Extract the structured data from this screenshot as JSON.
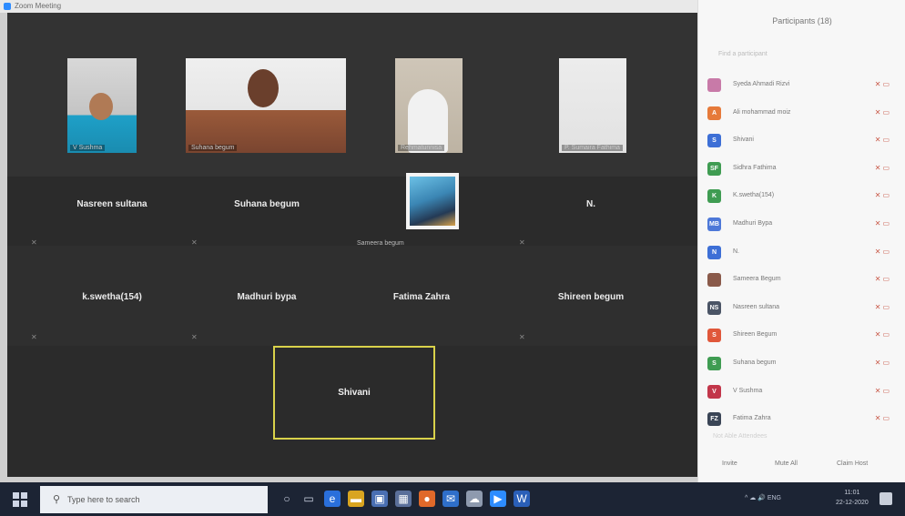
{
  "window": {
    "title": "Zoom Meeting"
  },
  "video_tiles": [
    {
      "label": "V Sushma"
    },
    {
      "label": "Suhana begum"
    },
    {
      "label": "Rehmatunnisa"
    },
    {
      "label": "P. Sumaira Fathima"
    }
  ],
  "name_tiles": [
    "Nasreen sultana",
    "Suhana begum",
    "N.",
    "k.swetha(154)",
    "Madhuri bypa",
    "Fatima Zahra",
    "Shireen begum"
  ],
  "avatar_tile": {
    "label": "Sameera begum"
  },
  "active_speaker": {
    "name": "Shivani"
  },
  "participants_panel": {
    "title": "Participants (18)",
    "search_placeholder": "Find a participant",
    "participants": [
      {
        "initials": "",
        "name": "Syeda Ahmadi Rizvi",
        "color": "#c87aa8"
      },
      {
        "initials": "A",
        "name": "Ali mohammad moiz",
        "color": "#e67a3a"
      },
      {
        "initials": "S",
        "name": "Shivani",
        "color": "#3d6fd6"
      },
      {
        "initials": "SF",
        "name": "Sidhra Fathima",
        "color": "#3f9c52"
      },
      {
        "initials": "K",
        "name": "K.swetha(154)",
        "color": "#3f9c52"
      },
      {
        "initials": "MB",
        "name": "Madhuri Bypa",
        "color": "#4d78d8"
      },
      {
        "initials": "N",
        "name": "N.",
        "color": "#3d6fd6"
      },
      {
        "initials": "",
        "name": "Sameera Begum",
        "color": "#8a5a4a"
      },
      {
        "initials": "NS",
        "name": "Nasreen sultana",
        "color": "#4b5566"
      },
      {
        "initials": "S",
        "name": "Shireen Begum",
        "color": "#e0573a"
      },
      {
        "initials": "S",
        "name": "Suhana begum",
        "color": "#3f9c52"
      },
      {
        "initials": "V",
        "name": "V Sushma",
        "color": "#c2364a"
      },
      {
        "initials": "FZ",
        "name": "Fatima Zahra",
        "color": "#3a4556"
      }
    ],
    "section_label": "Not Able Attendees",
    "buttons": {
      "invite": "Invite",
      "mute_all": "Mute All",
      "more": "Claim Host"
    }
  },
  "taskbar": {
    "search_placeholder": "Type here to search",
    "tray_status": "^ ☁ 🔊 ENG",
    "time": "11:01",
    "date": "22-12-2020"
  }
}
